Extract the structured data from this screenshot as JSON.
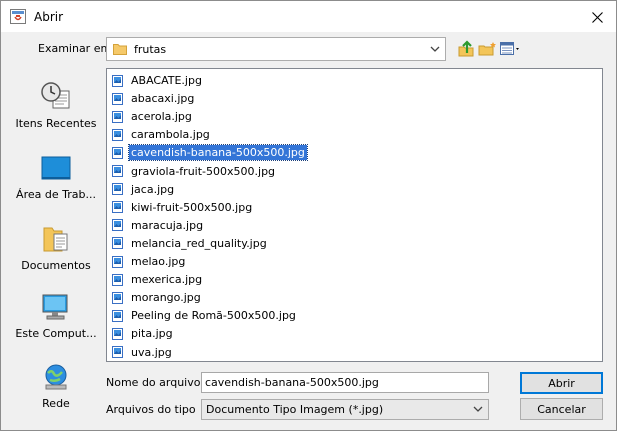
{
  "window": {
    "title": "Abrir"
  },
  "lookin": {
    "label": "Examinar em",
    "value": "frutas"
  },
  "sidebar": {
    "items": [
      {
        "label": "Itens Recentes"
      },
      {
        "label": "Área de Trab..."
      },
      {
        "label": "Documentos"
      },
      {
        "label": "Este Comput..."
      },
      {
        "label": "Rede"
      }
    ]
  },
  "files": [
    "ABACATE.jpg",
    "abacaxi.jpg",
    "acerola.jpg",
    "carambola.jpg",
    "cavendish-banana-500x500.jpg",
    "graviola-fruit-500x500.jpg",
    "jaca.jpg",
    "kiwi-fruit-500x500.jpg",
    "maracuja.jpg",
    "melancia_red_quality.jpg",
    "melao.jpg",
    "mexerica.jpg",
    "morango.jpg",
    "Peeling de Romã-500x500.jpg",
    "pita.jpg",
    "uva.jpg"
  ],
  "selected_file": "cavendish-banana-500x500.jpg",
  "filename": {
    "label": "Nome do arquivo",
    "value": "cavendish-banana-500x500.jpg"
  },
  "filetype": {
    "label": "Arquivos do tipo",
    "value": "Documento Tipo Imagem (*.jpg)"
  },
  "buttons": {
    "open": "Abrir",
    "cancel": "Cancelar"
  },
  "colors": {
    "selection": "#3375d7",
    "accent": "#0078d7"
  }
}
